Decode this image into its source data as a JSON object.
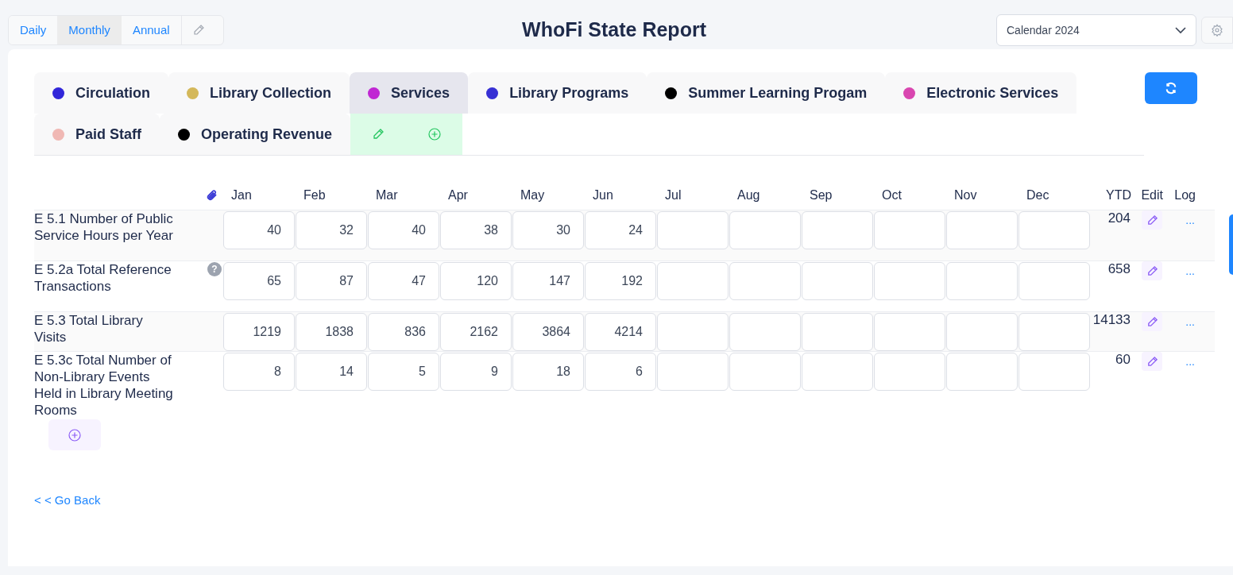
{
  "view_switch": [
    {
      "label": "Daily",
      "selected": false
    },
    {
      "label": "Monthly",
      "selected": true
    },
    {
      "label": "Annual",
      "selected": false
    }
  ],
  "title": "WhoFi State Report",
  "period_select": {
    "value": "Calendar 2024"
  },
  "categories": [
    {
      "label": "Circulation",
      "color": "#3126d9",
      "selected": false
    },
    {
      "label": "Library Collection",
      "color": "#d4b85a",
      "selected": false
    },
    {
      "label": "Services",
      "color": "#c026d3",
      "selected": true
    },
    {
      "label": "Library Programs",
      "color": "#3730d4",
      "selected": false
    },
    {
      "label": "Summer Learning Progam",
      "color": "#000000",
      "selected": false
    },
    {
      "label": "Electronic Services",
      "color": "#d946b0",
      "selected": false
    },
    {
      "label": "Paid Staff",
      "color": "#f0b8b4",
      "selected": false
    },
    {
      "label": "Operating Revenue",
      "color": "#000000",
      "selected": false
    }
  ],
  "table": {
    "months": [
      "Jan",
      "Feb",
      "Mar",
      "Apr",
      "May",
      "Jun",
      "Jul",
      "Aug",
      "Sep",
      "Oct",
      "Nov",
      "Dec"
    ],
    "ytd_header": "YTD",
    "edit_header": "Edit",
    "log_header": "Log",
    "rows": [
      {
        "label": "E 5.1 Number of Public Service Hours per Year",
        "values": [
          "40",
          "32",
          "40",
          "38",
          "30",
          "24"
        ],
        "ytd": "204",
        "log": "..."
      },
      {
        "label": "E 5.2a Total Reference Transactions",
        "help": "?",
        "values": [
          "65",
          "87",
          "47",
          "120",
          "147",
          "192"
        ],
        "ytd": "658",
        "log": "..."
      },
      {
        "label": "E 5.3 Total Library Visits",
        "values": [
          "1219",
          "1838",
          "836",
          "2162",
          "3864",
          "4214"
        ],
        "ytd": "14133",
        "log": "..."
      },
      {
        "label": "E 5.3c Total Number of Non-Library Events Held in Library Meeting Rooms",
        "values": [
          "8",
          "14",
          "5",
          "9",
          "18",
          "6"
        ],
        "ytd": "60",
        "log": "..."
      }
    ]
  },
  "back_link": "< < Go Back"
}
